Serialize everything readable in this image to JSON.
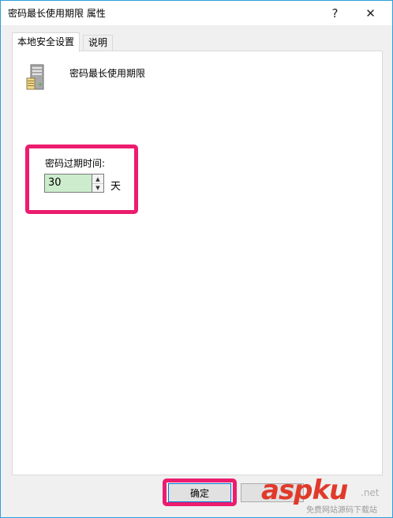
{
  "window": {
    "title": "密码最长使用期限 属性",
    "help_glyph": "?",
    "close_glyph": "✕"
  },
  "tabs": [
    {
      "label": "本地安全设置",
      "active": true
    },
    {
      "label": "说明",
      "active": false
    }
  ],
  "policy": {
    "icon": "server-icon",
    "title": "密码最长使用期限"
  },
  "expiry": {
    "label": "密码过期时间:",
    "value": "30",
    "unit": "天",
    "spin_up_glyph": "▲",
    "spin_down_glyph": "▼"
  },
  "buttons": {
    "ok": "确定",
    "cancel": ""
  },
  "highlight_color": "#ec1c6e",
  "watermark": {
    "brand": "aspku",
    "suffix": ".net",
    "tagline": "免费网站源码下载站"
  }
}
